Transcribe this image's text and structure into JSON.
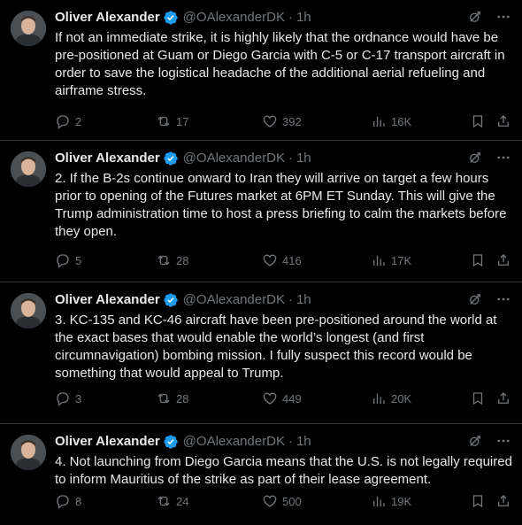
{
  "colors": {
    "background": "#000000",
    "text_primary": "#e7e9ea",
    "text_secondary": "#71767b",
    "verified_badge": "#1d9bf0",
    "divider": "#2f3336"
  },
  "tweets": [
    {
      "author_name": "Oliver Alexander",
      "handle": "@OAlexanderDK",
      "separator": "·",
      "time": "1h",
      "text": "If not an immediate strike, it is highly likely that the ordnance would have be pre-positioned at Guam or Diego Garcia with C-5 or C-17 transport aircraft in order to save the logistical headache of the additional aerial refueling and airframe stress.",
      "replies": "2",
      "reposts": "17",
      "likes": "392",
      "views": "16K"
    },
    {
      "author_name": "Oliver Alexander",
      "handle": "@OAlexanderDK",
      "separator": "·",
      "time": "1h",
      "text": "2. If the B-2s continue onward to Iran they will arrive on target a few hours prior to opening of the Futures market at 6PM ET Sunday. This will give the Trump administration time to host a press briefing to calm the markets before they open.",
      "replies": "5",
      "reposts": "28",
      "likes": "416",
      "views": "17K"
    },
    {
      "author_name": "Oliver Alexander",
      "handle": "@OAlexanderDK",
      "separator": "·",
      "time": "1h",
      "text": "3. KC-135 and KC-46 aircraft have been pre-positioned around the world at the exact bases that would enable the world’s longest (and first circumnavigation) bombing mission. I fully suspect this record would be something that would appeal to Trump.",
      "replies": "3",
      "reposts": "28",
      "likes": "449",
      "views": "20K"
    },
    {
      "author_name": "Oliver Alexander",
      "handle": "@OAlexanderDK",
      "separator": "·",
      "time": "1h",
      "text": "4. Not launching from Diego Garcia means that the U.S. is not legally required to inform Mauritius of the strike as part of their lease agreement.",
      "replies": "8",
      "reposts": "24",
      "likes": "500",
      "views": "19K"
    }
  ],
  "icons": {
    "verified": "verified-badge-icon",
    "grok": "grok-icon",
    "more": "more-icon",
    "reply": "reply-icon",
    "repost": "repost-icon",
    "like": "like-icon",
    "views": "views-icon",
    "bookmark": "bookmark-icon",
    "share": "share-icon"
  }
}
